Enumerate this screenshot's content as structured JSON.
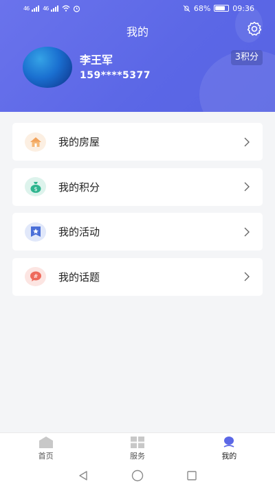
{
  "status_bar": {
    "signal1": "46",
    "signal2": "46",
    "battery": "68%",
    "time": "09:36"
  },
  "header": {
    "title": "我的"
  },
  "profile": {
    "name": "李王军",
    "phone": "159****5377",
    "points": "3积分"
  },
  "menu": {
    "items": [
      {
        "label": "我的房屋",
        "icon": "house-icon",
        "color": "#f2a35c",
        "bg": "#fcefe2"
      },
      {
        "label": "我的积分",
        "icon": "money-bag-icon",
        "color": "#2fb58f",
        "bg": "#ddf3ec"
      },
      {
        "label": "我的活动",
        "icon": "star-flag-icon",
        "color": "#4a6fd8",
        "bg": "#e1e8fa"
      },
      {
        "label": "我的话题",
        "icon": "hash-bubble-icon",
        "color": "#ee6a5c",
        "bg": "#fce5e2"
      }
    ]
  },
  "tabbar": {
    "tabs": [
      {
        "label": "首页",
        "icon": "home-icon"
      },
      {
        "label": "服务",
        "icon": "grid-icon"
      },
      {
        "label": "我的",
        "icon": "user-icon"
      }
    ],
    "active": "我的"
  },
  "nav": {
    "icons": [
      "back-icon",
      "home-circle-icon",
      "recents-icon"
    ]
  }
}
